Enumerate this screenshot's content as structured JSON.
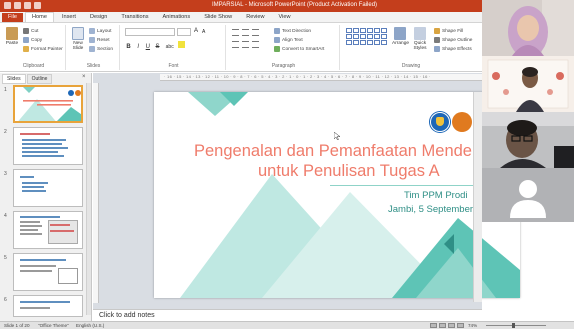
{
  "window": {
    "title": "IMPARSIAL - Microsoft PowerPoint (Product Activation Failed)"
  },
  "tabs": [
    {
      "label": "File"
    },
    {
      "label": "Home"
    },
    {
      "label": "Insert"
    },
    {
      "label": "Design"
    },
    {
      "label": "Transitions"
    },
    {
      "label": "Animations"
    },
    {
      "label": "Slide Show"
    },
    {
      "label": "Review"
    },
    {
      "label": "View"
    }
  ],
  "ribbon": {
    "clipboard": {
      "label": "Clipboard",
      "paste": "Paste",
      "cut": "Cut",
      "copy": "Copy",
      "format_painter": "Format Painter"
    },
    "slides": {
      "label": "Slides",
      "new_slide": "New Slide",
      "layout": "Layout",
      "reset": "Reset",
      "section": "Section"
    },
    "font": {
      "label": "Font",
      "bold": "B",
      "italic": "I",
      "underline": "U",
      "strikethrough": "S",
      "shadow": "abc",
      "grow": "A",
      "shrink": "A"
    },
    "paragraph": {
      "label": "Paragraph",
      "text_direction": "Text Direction",
      "align_text": "Align Text",
      "smartart": "Convert to SmartArt"
    },
    "drawing": {
      "label": "Drawing",
      "arrange": "Arrange",
      "quick_styles": "Quick Styles",
      "shape_fill": "Shape Fill",
      "shape_outline": "Shape Outline",
      "shape_effects": "Shape Effects"
    }
  },
  "left_pane": {
    "tab_slides": "Slides",
    "tab_outline": "Outline",
    "close": "×",
    "thumbnails": [
      {
        "num": "1"
      },
      {
        "num": "2"
      },
      {
        "num": "3"
      },
      {
        "num": "4"
      },
      {
        "num": "5"
      },
      {
        "num": "6"
      }
    ]
  },
  "slide": {
    "title_line1": "Pengenalan dan Pemanfaatan Mende",
    "title_line2": "untuk Penulisan Tugas A",
    "subtitle_line1": "Tim PPM Prodi",
    "subtitle_line2": "Jambi, 5 September"
  },
  "notes": {
    "placeholder": "Click to add notes"
  },
  "status": {
    "slide_info": "Slide 1 of 20",
    "theme": "\"Office Theme\"",
    "language": "English (U.S.)",
    "zoom": "74%"
  },
  "colors": {
    "accent_red": "#c43e1c",
    "title_coral": "#ef7c6b",
    "teal": "#5ec4b6",
    "teal_dark": "#2f8f86"
  }
}
